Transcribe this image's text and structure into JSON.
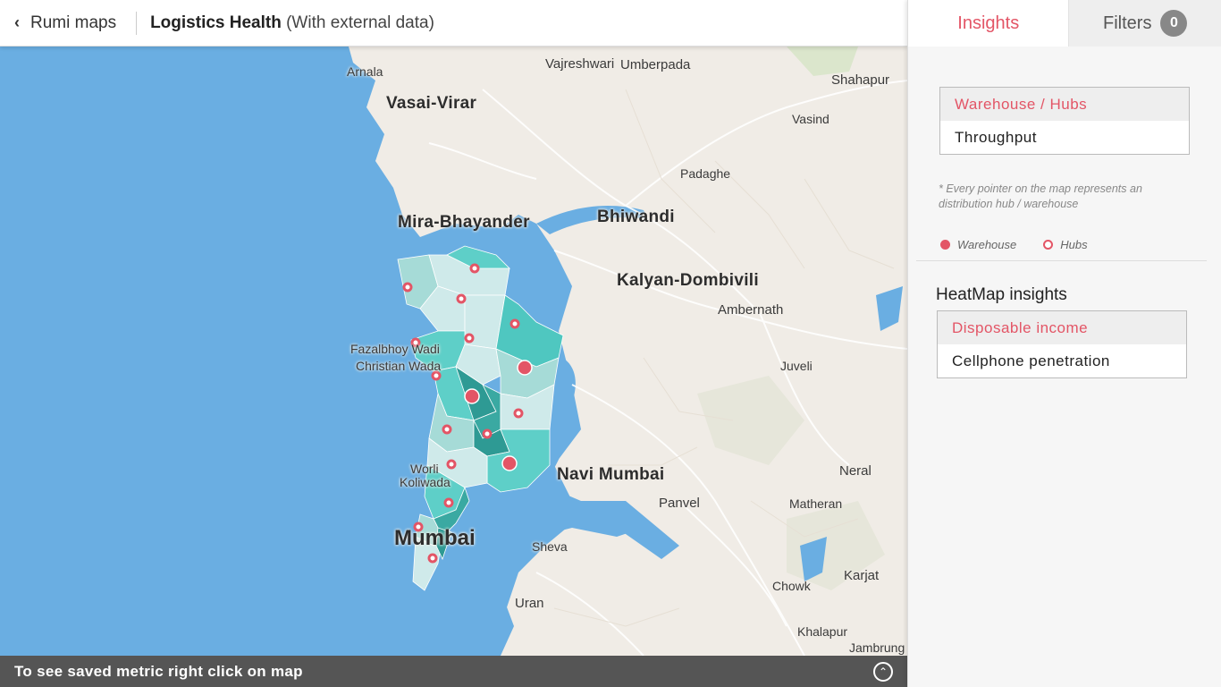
{
  "topbar": {
    "back_label": "Rumi maps",
    "title_bold": "Logistics Health",
    "title_sub": "(With external data)"
  },
  "map": {
    "places": [
      {
        "id": "arnala",
        "label": "Arnala"
      },
      {
        "id": "vajreshwari",
        "label": "Vajreshwari"
      },
      {
        "id": "umberpada",
        "label": "Umberpada"
      },
      {
        "id": "shahapur",
        "label": "Shahapur"
      },
      {
        "id": "vasai",
        "label": "Vasai-Virar"
      },
      {
        "id": "vasind",
        "label": "Vasind"
      },
      {
        "id": "padaghe",
        "label": "Padaghe"
      },
      {
        "id": "mira",
        "label": "Mira-Bhayander"
      },
      {
        "id": "bhiwandi",
        "label": "Bhiwandi"
      },
      {
        "id": "kalyan",
        "label": "Kalyan-Dombivili"
      },
      {
        "id": "ambernath",
        "label": "Ambernath"
      },
      {
        "id": "fazal1",
        "label": "Fazalbhoy Wadi"
      },
      {
        "id": "fazal2",
        "label": "Christian Wada"
      },
      {
        "id": "juveli",
        "label": "Juveli"
      },
      {
        "id": "navi",
        "label": "Navi Mumbai"
      },
      {
        "id": "neral",
        "label": "Neral"
      },
      {
        "id": "worli",
        "label": "Worli"
      },
      {
        "id": "koliwada",
        "label": "Koliwada"
      },
      {
        "id": "panvel",
        "label": "Panvel"
      },
      {
        "id": "matheran",
        "label": "Matheran"
      },
      {
        "id": "mumbai",
        "label": "Mumbai"
      },
      {
        "id": "sheva",
        "label": "Sheva"
      },
      {
        "id": "karjat",
        "label": "Karjat"
      },
      {
        "id": "chowk",
        "label": "Chowk"
      },
      {
        "id": "uran",
        "label": "Uran"
      },
      {
        "id": "khalapur",
        "label": "Khalapur"
      },
      {
        "id": "jambrung",
        "label": "Jambrung"
      }
    ],
    "colors": {
      "sea": "#6aaee2",
      "land": "#f0ece6",
      "heat_low": "#cfeaea",
      "heat_mid": "#5ecfc8",
      "heat_high": "#2e9a94",
      "marker": "#e35566"
    }
  },
  "bottombar": {
    "hint": "To see saved metric right click on map",
    "toggle_icon": "chevron-up-circle-icon"
  },
  "panel": {
    "tabs": {
      "insights": "Insights",
      "filters": "Filters",
      "filters_count": "0"
    },
    "layer_options": [
      {
        "label": "Warehouse / Hubs",
        "selected": true
      },
      {
        "label": "Throughput",
        "selected": false
      }
    ],
    "note": "* Every pointer on the map represents an distribution hub / warehouse",
    "legend": {
      "warehouse": "Warehouse",
      "hubs": "Hubs"
    },
    "heatmap_title": "HeatMap insights",
    "heatmap_options": [
      {
        "label": "Disposable income",
        "selected": true
      },
      {
        "label": "Cellphone penetration",
        "selected": false
      }
    ]
  }
}
